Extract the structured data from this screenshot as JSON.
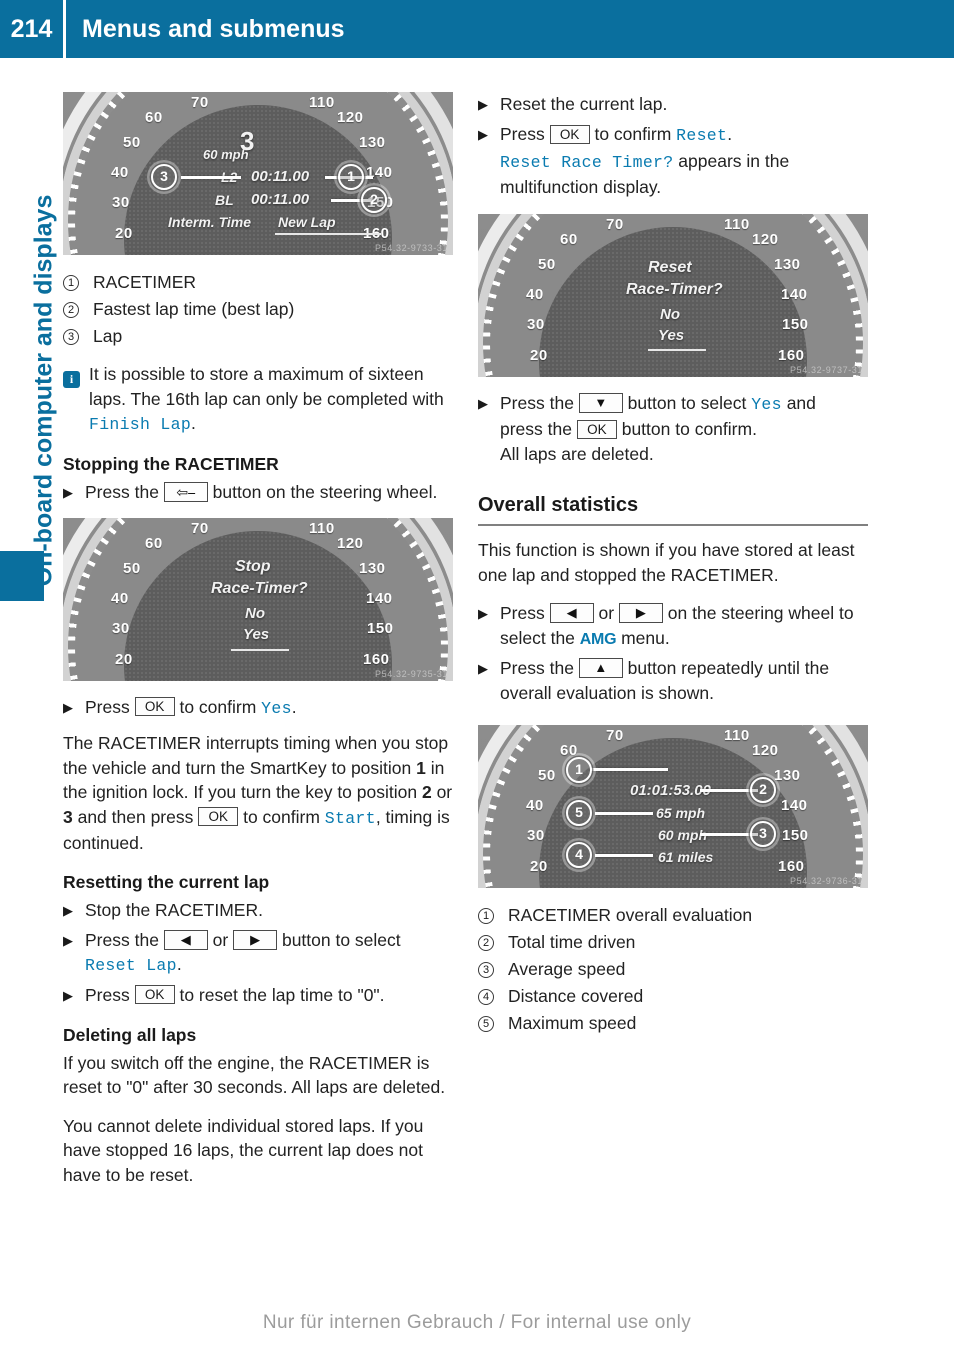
{
  "header": {
    "page_number": "214",
    "title": "Menus and submenus"
  },
  "sidebar": {
    "chapter_label": "On-board computer and displays"
  },
  "footer": {
    "text": "Nur für internen Gebrauch / For internal use only"
  },
  "left_column": {
    "image1": {
      "gear": "3",
      "speed": "60 mph",
      "row1_label": "L2",
      "row1_time": "00:11.00",
      "row2_label": "BL",
      "row2_time": "00:11.00",
      "footer_left": "Interm. Time",
      "footer_right": "New Lap",
      "callouts": [
        "1",
        "2",
        "3"
      ],
      "watermark": "P54.32-9733-31",
      "ticks": [
        "20",
        "30",
        "40",
        "50",
        "60",
        "70",
        "110",
        "120",
        "130",
        "140",
        "150",
        "160"
      ]
    },
    "legend": [
      {
        "num": "1",
        "text": "RACETIMER"
      },
      {
        "num": "2",
        "text": "Fastest lap time (best lap)"
      },
      {
        "num": "3",
        "text": "Lap"
      }
    ],
    "note": {
      "text_part1": "It is possible to store a maximum of sixteen laps. The 16th lap can only be completed with ",
      "display_term": "Finish Lap",
      "text_part2": "."
    },
    "stopping": {
      "heading": "Stopping the RACETIMER",
      "step1_before": "Press the ",
      "step1_key": "back-arrow",
      "step1_after": " button on the steering wheel."
    },
    "image2": {
      "line1": "Stop",
      "line2": "Race-Timer?",
      "option_no": "No",
      "option_yes": "Yes",
      "watermark": "P54.32-9735-31",
      "ticks": [
        "20",
        "30",
        "40",
        "50",
        "60",
        "70",
        "110",
        "120",
        "130",
        "140",
        "150",
        "160"
      ]
    },
    "confirm_yes": {
      "before": "Press ",
      "key": "OK",
      "middle": " to confirm ",
      "term": "Yes",
      "after": "."
    },
    "interrupt_para": {
      "p1": "The RACETIMER interrupts timing when you stop the vehicle and turn the SmartKey to position ",
      "pos1": "1",
      "p2": " in the ignition lock. If you turn the key to position ",
      "pos2": "2",
      "p3": " or ",
      "pos3": "3",
      "p4": " and then press ",
      "key": "OK",
      "p5": " to confirm ",
      "term": "Start",
      "p6": ", timing is continued."
    },
    "resetting": {
      "heading": "Resetting the current lap",
      "step1": "Stop the RACETIMER.",
      "step2_before": "Press the ",
      "step2_or": " or ",
      "step2_after": " button to select ",
      "step2_term": "Reset Lap",
      "step2_end": ".",
      "step3_before": "Press ",
      "step3_key": "OK",
      "step3_after": " to reset the lap time to \"0\"."
    },
    "deleting": {
      "heading": "Deleting all laps",
      "para1": "If you switch off the engine, the RACETIMER is reset to \"0\" after 30 seconds. All laps are deleted.",
      "para2": "You cannot delete individual stored laps. If you have stopped 16 laps, the current lap does not have to be reset."
    }
  },
  "right_column": {
    "step_reset": "Reset the current lap.",
    "step_confirm": {
      "before": "Press ",
      "key": "OK",
      "middle": " to confirm ",
      "term": "Reset",
      "after": ".",
      "line2_term": "Reset Race Timer?",
      "line2_after": " appears in the multifunction display."
    },
    "image3": {
      "line1": "Reset",
      "line2": "Race-Timer?",
      "option_no": "No",
      "option_yes": "Yes",
      "watermark": "P54.32-9737-31",
      "ticks": [
        "20",
        "30",
        "40",
        "50",
        "60",
        "70",
        "110",
        "120",
        "130",
        "140",
        "150",
        "160"
      ]
    },
    "step_yes": {
      "before": "Press the ",
      "after": " button to select ",
      "term": "Yes",
      "and": " and",
      "line2_before": "press the ",
      "line2_key": "OK",
      "line2_after": " button to confirm.",
      "line3": "All laps are deleted."
    },
    "overall": {
      "heading": "Overall statistics",
      "intro": "This function is shown if you have stored at least one lap and stopped the RACETIMER.",
      "step1_before": "Press ",
      "step1_or": " or ",
      "step1_after": " on the steering wheel to select the ",
      "step1_term": "AMG",
      "step1_end": " menu.",
      "step2_before": "Press the ",
      "step2_after": " button repeatedly until the overall evaluation is shown."
    },
    "image4": {
      "total_time": "01:01:53.00",
      "max_speed": "65 mph",
      "avg_speed": "60 mph",
      "distance": "61 miles",
      "callouts": [
        "1",
        "2",
        "3",
        "4",
        "5"
      ],
      "watermark": "P54.32-9736-31",
      "ticks": [
        "20",
        "30",
        "40",
        "50",
        "60",
        "70",
        "110",
        "120",
        "130",
        "140",
        "150",
        "160"
      ]
    },
    "legend": [
      {
        "num": "1",
        "text": "RACETIMER overall evaluation"
      },
      {
        "num": "2",
        "text": "Total time driven"
      },
      {
        "num": "3",
        "text": "Average speed"
      },
      {
        "num": "4",
        "text": "Distance covered"
      },
      {
        "num": "5",
        "text": "Maximum speed"
      }
    ]
  },
  "colors": {
    "brand_blue": "#0a6f9e",
    "display_term_blue": "#0a7bb0",
    "text": "#222222"
  }
}
